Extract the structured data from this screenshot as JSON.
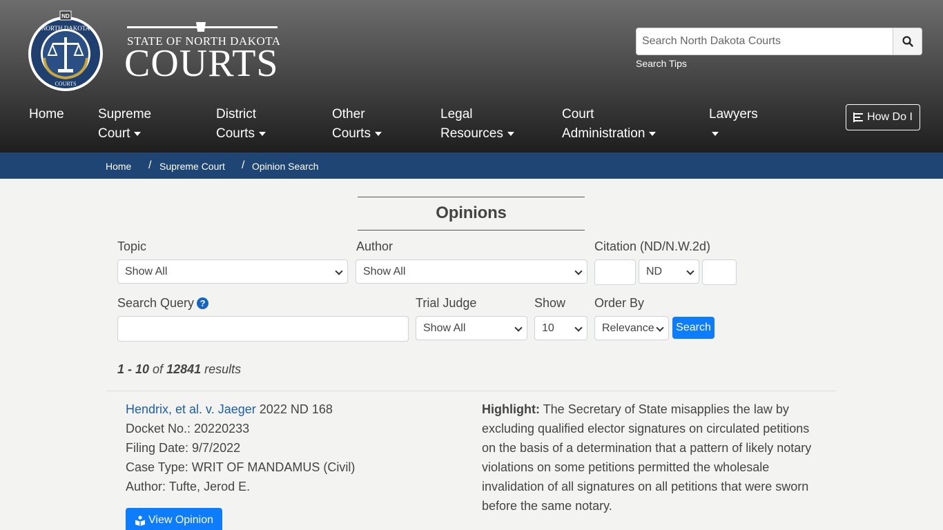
{
  "header": {
    "seal": {
      "top_text": "NORTH DAKOTA",
      "badge": "ND",
      "bottom_text": "COURTS"
    },
    "wordmark_state": "STATE OF NORTH DAKOTA",
    "wordmark_courts": "COURTS",
    "search": {
      "placeholder": "Search North Dakota Courts",
      "value": "",
      "icon": "search-icon",
      "tips_label": "Search Tips"
    },
    "nav": [
      {
        "line1": "Home",
        "line2": ""
      },
      {
        "line1": "Supreme",
        "line2": "Court"
      },
      {
        "line1": "District",
        "line2": "Courts"
      },
      {
        "line1": "Other",
        "line2": "Courts"
      },
      {
        "line1": "Legal",
        "line2": "Resources"
      },
      {
        "line1": "Court",
        "line2": "Administration"
      },
      {
        "line1": "Lawyers",
        "line2": ""
      }
    ],
    "how_do_i": "How Do I"
  },
  "breadcrumb": [
    "Home",
    "Supreme Court",
    "Opinion Search"
  ],
  "page_title": "Opinions",
  "filters": {
    "topic": {
      "label": "Topic",
      "value": "Show All"
    },
    "author": {
      "label": "Author",
      "value": "Show All"
    },
    "citation": {
      "label": "Citation (ND/N.W.2d)",
      "volume": "",
      "reporter": "ND",
      "page": ""
    },
    "query": {
      "label": "Search Query",
      "value": ""
    },
    "trial_judge": {
      "label": "Trial Judge",
      "value": "Show All"
    },
    "show": {
      "label": "Show",
      "value": "10"
    },
    "order_by": {
      "label": "Order By",
      "value": "Relevance"
    },
    "search_button": "Search"
  },
  "results": {
    "range": "1 - 10",
    "of": "of",
    "total": "12841",
    "suffix": "results",
    "items": [
      {
        "title": "Hendrix, et al. v. Jaeger",
        "citation": "2022 ND 168",
        "docket": "Docket No.: 20220233",
        "filing_date": "Filing Date: 9/7/2022",
        "case_type": "Case Type: WRIT OF MANDAMUS (Civil)",
        "author": "Author: Tufte, Jerod E.",
        "highlight_label": "Highlight:",
        "highlight_text": "The Secretary of State misapplies the law by excluding qualified elector signatures on circulated petitions on the basis of a determination that a pattern of likely notary violations on some petitions permitted the wholesale invalidation of all signatures on all petitions that were sworn before the same notary.",
        "view_button": "View Opinion"
      }
    ]
  },
  "colors": {
    "crumb_bar": "#1f4575",
    "primary": "#0d7cff",
    "link": "#1c5eb0",
    "seal_blue": "#1f3f6e",
    "seal_gold": "#c9a53a"
  }
}
